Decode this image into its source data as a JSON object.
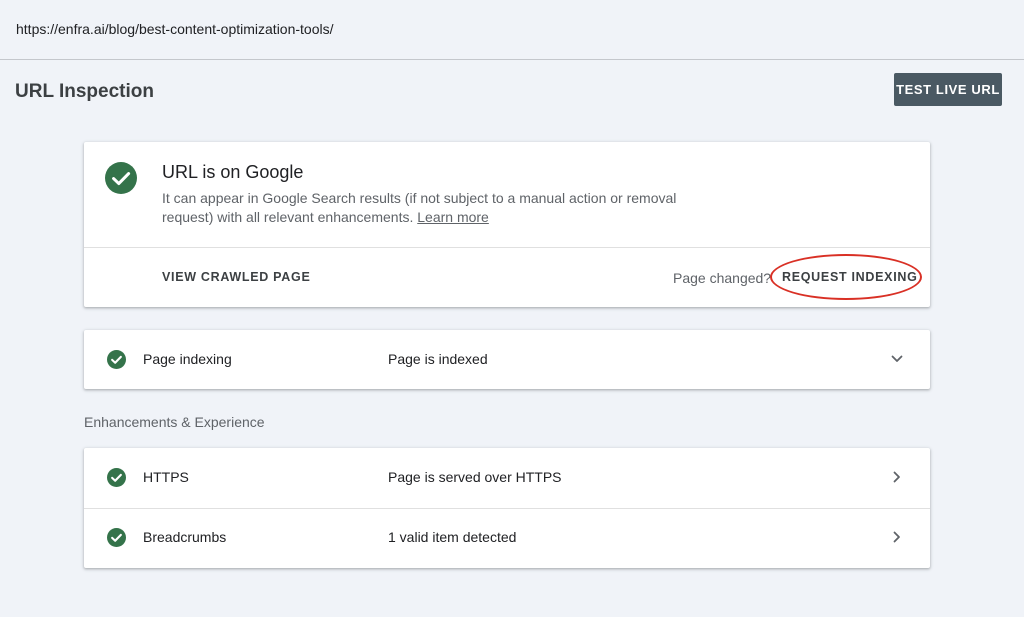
{
  "url_bar": {
    "url": "https://enfra.ai/blog/best-content-optimization-tools/"
  },
  "header": {
    "title": "URL Inspection",
    "test_live_label": "TEST LIVE URL"
  },
  "summary": {
    "title": "URL is on Google",
    "description": "It can appear in Google Search results (if not subject to a manual action or removal request) with all relevant enhancements.",
    "learn_more": "Learn more",
    "view_crawled_label": "VIEW CRAWLED PAGE",
    "page_changed_label": "Page changed?",
    "request_indexing_label": "REQUEST INDEXING",
    "status_icon": "check-circle-icon",
    "status_color": "#34734a",
    "highlight_color": "#d93025"
  },
  "indexing": {
    "label": "Page indexing",
    "value": "Page is indexed",
    "icon": "chevron-down-icon"
  },
  "enhancements": {
    "section_label": "Enhancements & Experience",
    "items": [
      {
        "label": "HTTPS",
        "value": "Page is served over HTTPS",
        "icon": "chevron-right-icon"
      },
      {
        "label": "Breadcrumbs",
        "value": "1 valid item detected",
        "icon": "chevron-right-icon"
      }
    ]
  },
  "colors": {
    "background": "#f0f3f8",
    "primary_button": "#4a5963",
    "success_green": "#34734a"
  }
}
